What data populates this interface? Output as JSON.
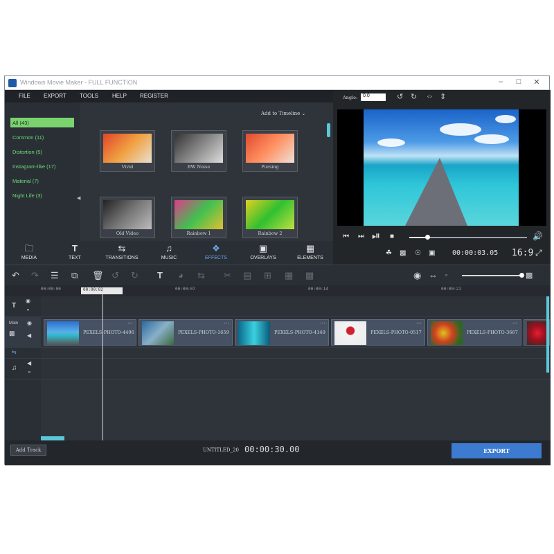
{
  "window": {
    "title": "Windows Movie Maker - FULL FUNCTION"
  },
  "menu": [
    "FILE",
    "EXPORT",
    "TOOLS",
    "HELP",
    "REGISTER"
  ],
  "categories": [
    {
      "label": "All (43)",
      "active": true
    },
    {
      "label": "Common (11)"
    },
    {
      "label": "Distortion (5)"
    },
    {
      "label": "Instagram-like (17)"
    },
    {
      "label": "Material (7)"
    },
    {
      "label": "Night Life (3)"
    }
  ],
  "library": {
    "add_to_timeline": "Add to Timeline",
    "effects": [
      "Vivid",
      "BW Noise",
      "Pursing",
      "Old Video",
      "Rainbow 1",
      "Rainbow 2"
    ]
  },
  "tabs": [
    {
      "label": "MEDIA",
      "icon": "folder-icon"
    },
    {
      "label": "TEXT",
      "icon": "text-icon"
    },
    {
      "label": "TRANSITIONS",
      "icon": "transitions-icon"
    },
    {
      "label": "MUSIC",
      "icon": "music-icon"
    },
    {
      "label": "EFFECTS",
      "icon": "effects-icon",
      "active": true
    },
    {
      "label": "OVERLAYS",
      "icon": "overlays-icon"
    },
    {
      "label": "ELEMENTS",
      "icon": "elements-icon"
    }
  ],
  "preview": {
    "angle_label": "Angle:",
    "angle_value": "0.0",
    "timecode": "00:00:03.05",
    "aspect": "16:9",
    "progress": 0.15
  },
  "ruler": {
    "ticks": [
      "00:00:00",
      "00:00:07",
      "00:00:14",
      "00:00:21"
    ],
    "playhead": "00:00:02"
  },
  "tracks": {
    "main_label": "Main",
    "clips": [
      "PEXELS-PHOTO-4496",
      "PEXELS-PHOTO-1659",
      "PEXELS-PHOTO-4140",
      "PEXELS-PHOTO-0517",
      "PEXELS-PHOTO-3667"
    ]
  },
  "bottom": {
    "add_track": "Add Track",
    "project_name": "UNTITLED_20",
    "duration": "00:00:30.00",
    "export": "EXPORT"
  },
  "colors": {
    "accent": "#3c7bd0",
    "category_green": "#7ad36f",
    "teal": "#5ac8d8"
  }
}
